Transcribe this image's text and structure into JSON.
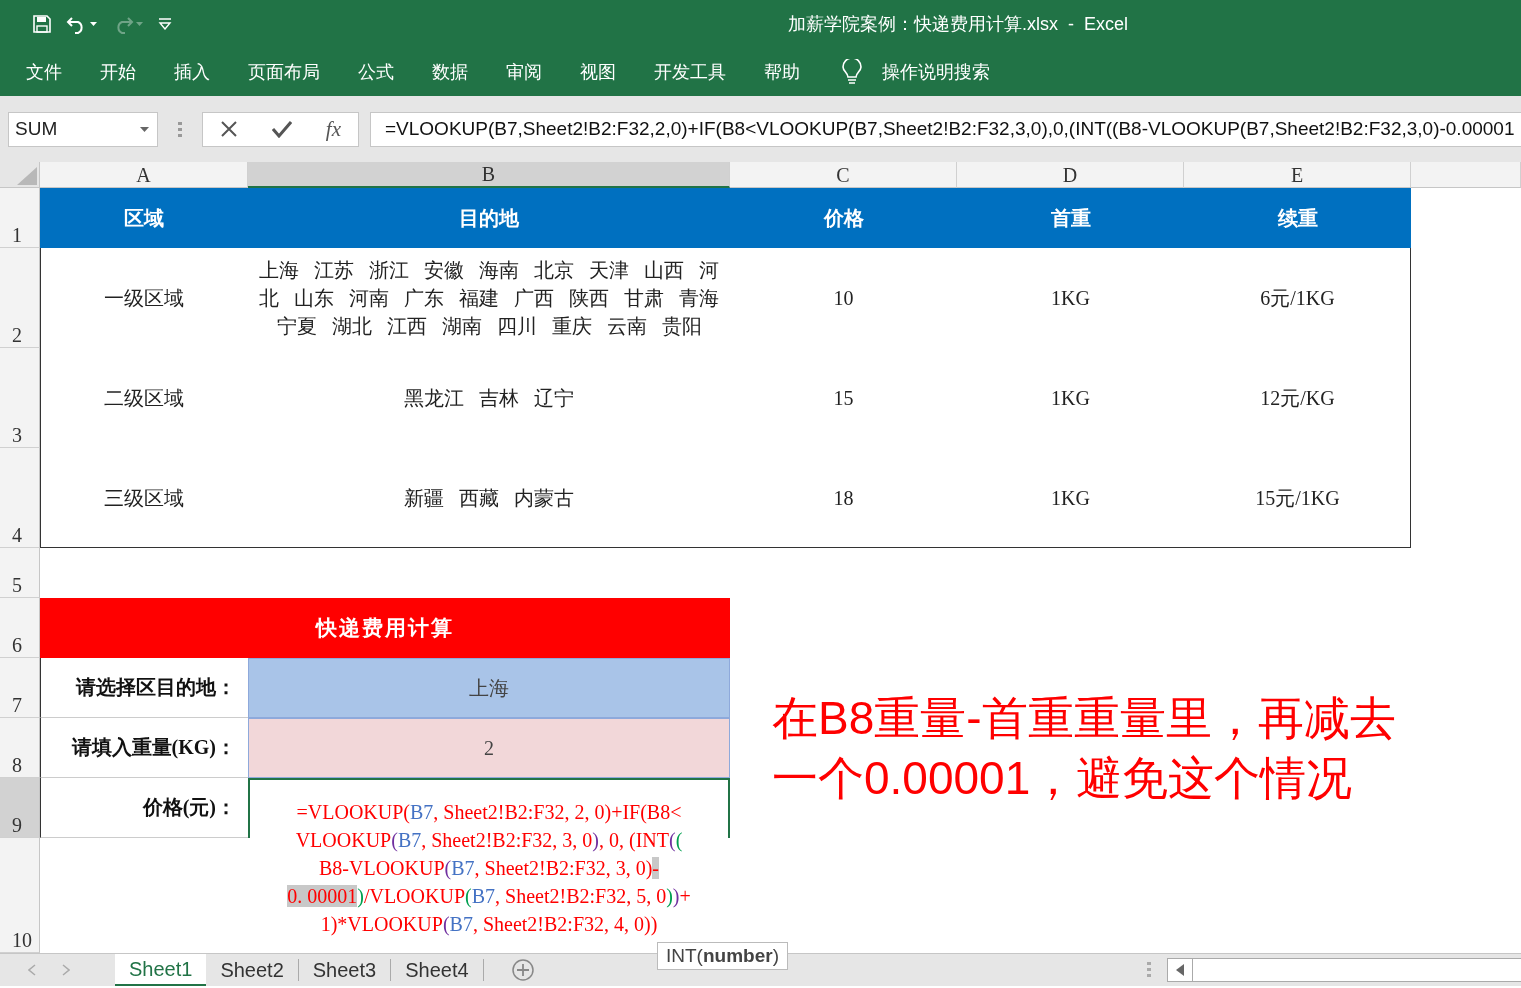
{
  "title_bar": {
    "title": "加薪学院案例：快递费用计算.xlsx  -  Excel",
    "redo_disabled": true
  },
  "ribbon_tabs": [
    {
      "label": "文件"
    },
    {
      "label": "开始"
    },
    {
      "label": "插入"
    },
    {
      "label": "页面布局"
    },
    {
      "label": "公式"
    },
    {
      "label": "数据"
    },
    {
      "label": "审阅"
    },
    {
      "label": "视图"
    },
    {
      "label": "开发工具"
    },
    {
      "label": "帮助"
    }
  ],
  "tell_me": "操作说明搜索",
  "formula_bar": {
    "name_box": "SUM",
    "fx": "fx",
    "formula": "=VLOOKUP(B7,Sheet2!B2:F32,2,0)+IF(B8<VLOOKUP(B7,Sheet2!B2:F32,3,0),0,(INT((B8-VLOOKUP(B7,Sheet2!B2:F32,3,0)-0.00001"
  },
  "columns": [
    {
      "label": "A",
      "selected": false
    },
    {
      "label": "B",
      "selected": true
    },
    {
      "label": "C",
      "selected": false
    },
    {
      "label": "D",
      "selected": false
    },
    {
      "label": "E",
      "selected": false
    }
  ],
  "row_numbers": [
    {
      "label": "1",
      "selected": false
    },
    {
      "label": "2",
      "selected": false
    },
    {
      "label": "3",
      "selected": false
    },
    {
      "label": "4",
      "selected": false
    },
    {
      "label": "5",
      "selected": false
    },
    {
      "label": "6",
      "selected": false
    },
    {
      "label": "7",
      "selected": false
    },
    {
      "label": "8",
      "selected": false
    },
    {
      "label": "9",
      "selected": true
    },
    {
      "label": "10",
      "selected": false
    }
  ],
  "table": {
    "headers": [
      "区域",
      "目的地",
      "价格",
      "首重",
      "续重"
    ],
    "rows": [
      [
        "一级区域",
        "上海 江苏 浙江 安徽 海南 北京 天津 山西 河北 山东 河南 广东 福建 广西 陕西 甘肃 青海宁夏 湖北 江西 湖南 四川 重庆 云南 贵阳",
        "10",
        "1KG",
        "6元/1KG"
      ],
      [
        "二级区域",
        "黑龙江 吉林 辽宁",
        "15",
        "1KG",
        "12元/KG"
      ],
      [
        "三级区域",
        "新疆 西藏 内蒙古",
        "18",
        "1KG",
        "15元/1KG"
      ]
    ]
  },
  "calculator": {
    "title": "快递费用计算",
    "fields": [
      {
        "label": "请选择区目的地：",
        "value": "上海",
        "color": "#a9c4e8"
      },
      {
        "label": "请填入重量(KG)：",
        "value": "2",
        "color": "#f2d7d9"
      },
      {
        "label": "价格(元)：",
        "color": "#ffffff",
        "formula_lines": [
          [
            {
              "text": "=VLOOKUP(",
              "color": "#ff0000",
              "selected": false
            },
            {
              "text": "B7",
              "color": "#4472c4",
              "selected": false
            },
            {
              "text": ", Sheet2!B2:F32, 2, 0)+IF(B8<",
              "color": "#ff0000",
              "selected": false
            }
          ],
          [
            {
              "text": "VLOOKUP",
              "color": "#ff0000",
              "selected": false
            },
            {
              "text": "(",
              "color": "#7030a0",
              "selected": false
            },
            {
              "text": "B7",
              "color": "#4472c4",
              "selected": false
            },
            {
              "text": ", Sheet2!B2:F32, 3, 0",
              "color": "#ff0000",
              "selected": false
            },
            {
              "text": ")",
              "color": "#7030a0",
              "selected": false
            },
            {
              "text": ", 0, (INT",
              "color": "#ff0000",
              "selected": false
            },
            {
              "text": "(",
              "color": "#7030a0",
              "selected": false
            },
            {
              "text": "(",
              "color": "#00a050",
              "selected": false
            }
          ],
          [
            {
              "text": "B8-VLOOKUP",
              "color": "#ff0000",
              "selected": false
            },
            {
              "text": "(",
              "color": "#7030a0",
              "selected": false
            },
            {
              "text": "B7",
              "color": "#4472c4",
              "selected": false
            },
            {
              "text": ", Sheet2!B2:F32, 3, 0)",
              "color": "#ff0000",
              "selected": false
            },
            {
              "text": "-",
              "color": "#ff0000",
              "selected": true
            }
          ],
          [
            {
              "text": "0. 00001",
              "color": "#ff0000",
              "selected": true
            },
            {
              "text": ")",
              "color": "#00a050",
              "selected": false
            },
            {
              "text": "/VLOOKUP",
              "color": "#ff0000",
              "selected": false
            },
            {
              "text": "(",
              "color": "#00a050",
              "selected": false
            },
            {
              "text": "B7",
              "color": "#4472c4",
              "selected": false
            },
            {
              "text": ", Sheet2!B2:F32, 5, 0",
              "color": "#ff0000",
              "selected": false
            },
            {
              "text": ")",
              "color": "#00a050",
              "selected": false
            },
            {
              "text": ")",
              "color": "#7030a0",
              "selected": false
            },
            {
              "text": "+",
              "color": "#ff0000",
              "selected": false
            }
          ],
          [
            {
              "text": "1)*VLOOKUP",
              "color": "#ff0000",
              "selected": false
            },
            {
              "text": "(",
              "color": "#7030a0",
              "selected": false
            },
            {
              "text": "B7",
              "color": "#4472c4",
              "selected": false
            },
            {
              "text": ", Sheet2!B2:F32, 4, 0))",
              "color": "#ff0000",
              "selected": false
            }
          ]
        ]
      }
    ]
  },
  "annotation": {
    "lines": [
      "在B8重量-首重重量里，再减去",
      "一个0.00001，避免这个情况"
    ]
  },
  "tooltip": "INT(**number**)",
  "sheet_tabs": [
    {
      "label": "Sheet1",
      "selected": true
    },
    {
      "label": "Sheet2",
      "selected": false
    },
    {
      "label": "Sheet3",
      "selected": false
    },
    {
      "label": "Sheet4",
      "selected": false
    }
  ]
}
